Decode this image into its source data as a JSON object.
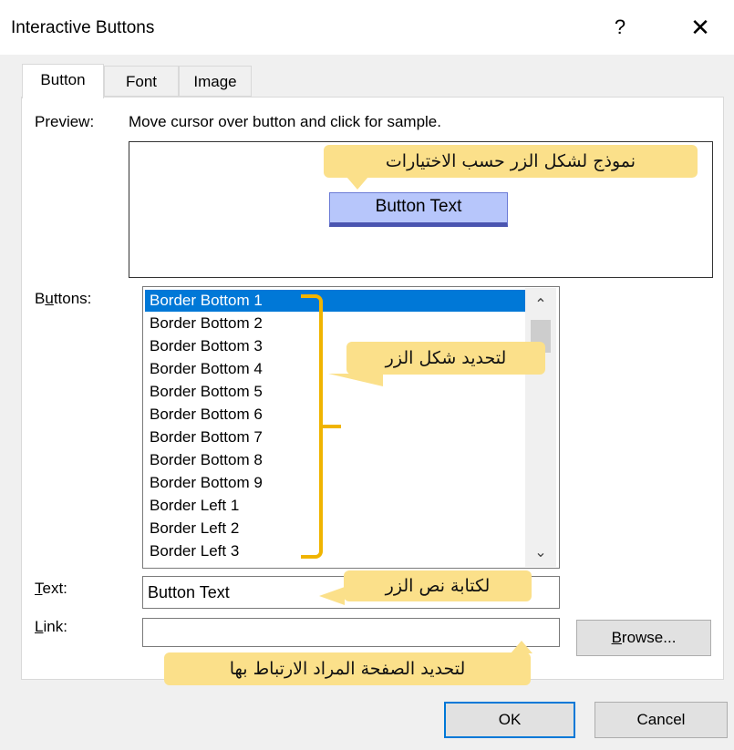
{
  "window": {
    "title": "Interactive Buttons",
    "help_glyph": "?",
    "close_glyph": "✕"
  },
  "tabs": [
    {
      "label": "Button",
      "active": true
    },
    {
      "label": "Font",
      "active": false
    },
    {
      "label": "Image",
      "active": false
    }
  ],
  "preview": {
    "label": "Preview:",
    "instruction": "Move cursor over button and click for sample.",
    "sample_button_text": "Button Text"
  },
  "buttons_list": {
    "label_pre": "B",
    "label_ul": "u",
    "label_post": "ttons:",
    "items": [
      "Border Bottom 1",
      "Border Bottom 2",
      "Border Bottom 3",
      "Border Bottom 4",
      "Border Bottom 5",
      "Border Bottom 6",
      "Border Bottom 7",
      "Border Bottom 8",
      "Border Bottom 9",
      "Border Left 1",
      "Border Left 2",
      "Border Left 3"
    ],
    "selected_index": 0
  },
  "text_field": {
    "label_ul": "T",
    "label_post": "ext:",
    "value": "Button Text"
  },
  "link_field": {
    "label_ul": "L",
    "label_post": "ink:",
    "value": ""
  },
  "browse_button": {
    "label_ul": "B",
    "label_post": "rowse..."
  },
  "ok_button": {
    "label": "OK"
  },
  "cancel_button": {
    "label": "Cancel"
  },
  "annotations": {
    "preview_note": "نموذج لشكل الزر حسب الاختيارات",
    "list_note": "لتحديد شكل الزر",
    "text_note": "لكتابة نص الزر",
    "link_note": "لتحديد الصفحة المراد الارتباط بها"
  },
  "colors": {
    "selection": "#0078d7",
    "callout": "#fbe08a",
    "bracket": "#f0b400",
    "sample_button": "#b7c6fb"
  }
}
